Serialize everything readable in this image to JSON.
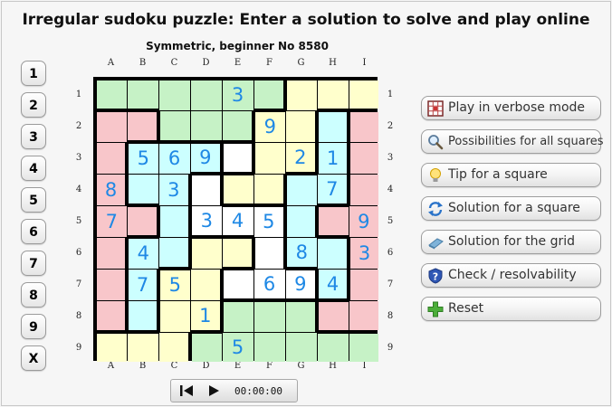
{
  "title": "Irregular sudoku puzzle: Enter a solution to solve and play online",
  "subtitle": "Symmetric, beginner No 8580",
  "number_buttons": [
    "1",
    "2",
    "3",
    "4",
    "5",
    "6",
    "7",
    "8",
    "9",
    "X"
  ],
  "columns": [
    "A",
    "B",
    "C",
    "D",
    "E",
    "F",
    "G",
    "H",
    "I"
  ],
  "rows": [
    "1",
    "2",
    "3",
    "4",
    "5",
    "6",
    "7",
    "8",
    "9"
  ],
  "digit_color": "#1e88e5",
  "region_colors": {
    "green": "#c6f2c6",
    "pink": "#f8c6ca",
    "yellow": "#ffffcc",
    "cyan": "#ccffff",
    "white": "#ffffff"
  },
  "regions": [
    "GGGGGGYYY",
    "PPGGGYYCP",
    "PCCCWYYCP",
    "PCCWYYCCP",
    "PPCWWWCPP",
    "PCCYYWCCP",
    "PCYYWWWCP",
    "PCYYGGGPP",
    "YYYGGGGGG"
  ],
  "givens": [
    "....3....",
    ".....9...",
    ".569..21.",
    "8.3....7.",
    "7..345..9",
    ".4....8.3",
    ".75..694.",
    "...1.....",
    "....5...."
  ],
  "side_buttons": [
    {
      "label": "Play in verbose mode",
      "icon": "grid-icon"
    },
    {
      "label": "Possibilities for all squares",
      "icon": "magnifier-icon"
    },
    {
      "label": "Tip for a square",
      "icon": "lightbulb-icon"
    },
    {
      "label": "Solution for a square",
      "icon": "refresh-icon"
    },
    {
      "label": "Solution for the grid",
      "icon": "eraser-icon"
    },
    {
      "label": "Check / resolvability",
      "icon": "shield-question-icon"
    },
    {
      "label": "Reset",
      "icon": "plus-icon"
    }
  ],
  "timer": "00:00:00"
}
